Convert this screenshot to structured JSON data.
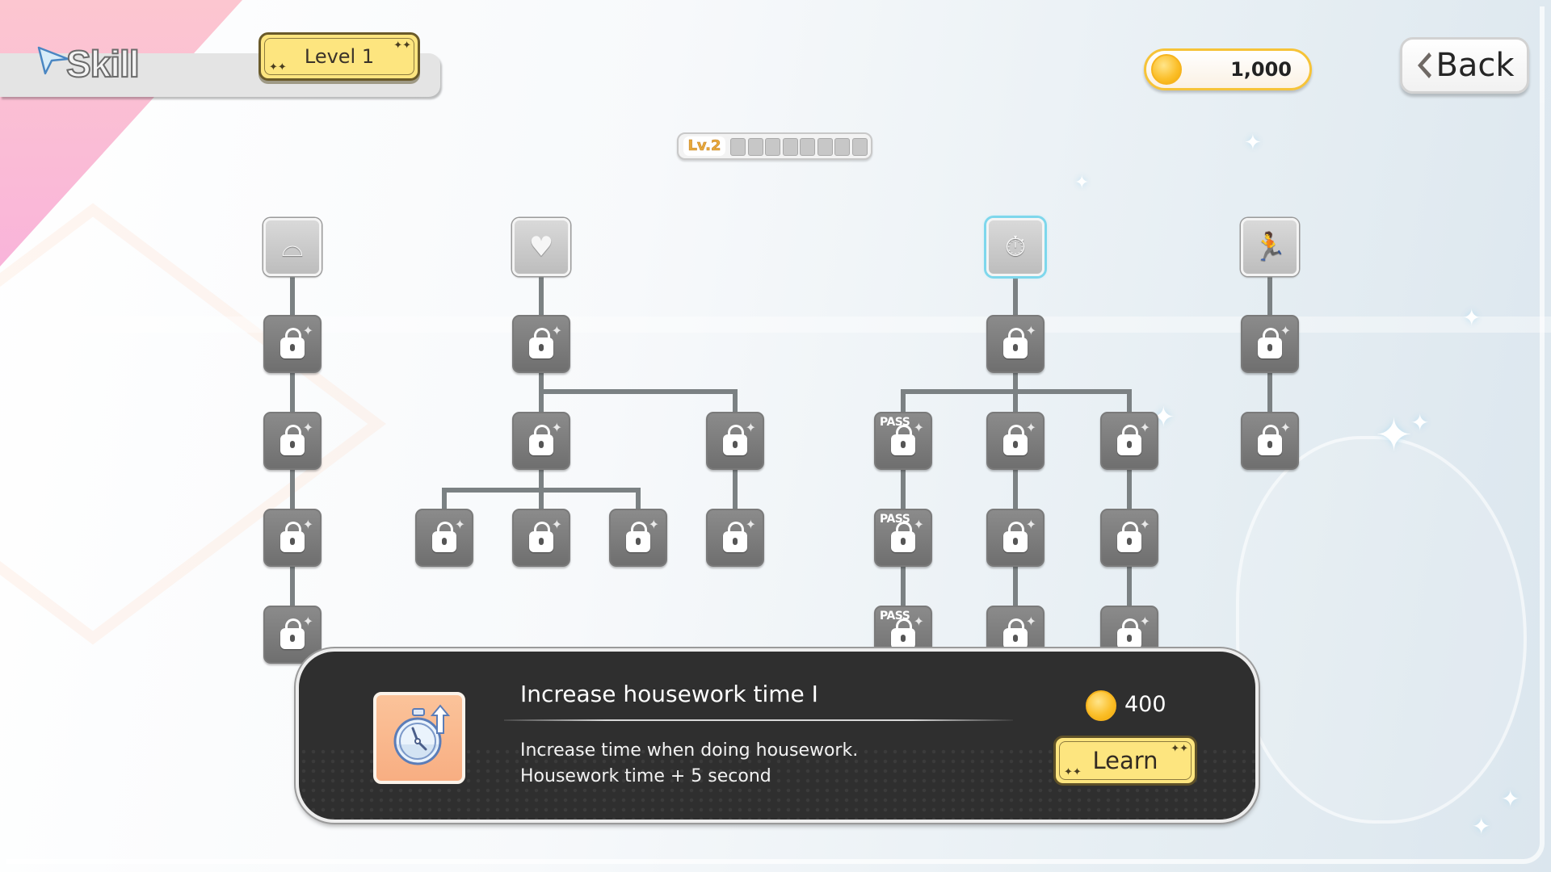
{
  "header": {
    "title": "Skill",
    "level_label": "Level 1",
    "coins": "1,000",
    "back_label": "Back"
  },
  "progress": {
    "level_label": "Lv.2",
    "segments_total": 8,
    "segments_filled": 0
  },
  "tree": {
    "nodes": [
      {
        "id": "laundry-root",
        "icon": "folded-towel-icon",
        "state": "unlocked",
        "glyph": "⌓"
      },
      {
        "id": "laundry-1",
        "icon": "laundry-icon",
        "state": "locked"
      },
      {
        "id": "laundry-2",
        "icon": "laundry-sparkle-icon",
        "state": "locked"
      },
      {
        "id": "laundry-3",
        "icon": "laundry-shine-icon",
        "state": "locked"
      },
      {
        "id": "laundry-4",
        "icon": "laundry-sleep-icon",
        "state": "locked"
      },
      {
        "id": "affection-root",
        "icon": "heart-up-icon",
        "state": "unlocked",
        "glyph": "♥"
      },
      {
        "id": "affection-1",
        "icon": "heart-sparkle-icon",
        "state": "locked"
      },
      {
        "id": "affection-2",
        "icon": "heart-glow-icon",
        "state": "locked"
      },
      {
        "id": "affection-2b",
        "icon": "gift-icon",
        "state": "locked"
      },
      {
        "id": "affection-3a",
        "icon": "character-heart-icon",
        "state": "locked"
      },
      {
        "id": "affection-3b",
        "icon": "character-heart-icon",
        "state": "locked"
      },
      {
        "id": "affection-3c",
        "icon": "character-heart-icon",
        "state": "locked"
      },
      {
        "id": "affection-3d",
        "icon": "gift-box-icon",
        "state": "locked"
      },
      {
        "id": "time-root",
        "icon": "stopwatch-up-icon",
        "state": "unlocked",
        "selected": true,
        "glyph": "⏱"
      },
      {
        "id": "time-1",
        "icon": "stopwatch-up-icon",
        "state": "locked"
      },
      {
        "id": "time-2a",
        "icon": "character-pass-icon",
        "state": "locked",
        "pass": "PASS"
      },
      {
        "id": "time-2b",
        "icon": "stopwatch-up-icon",
        "state": "locked"
      },
      {
        "id": "time-2c",
        "icon": "hand-up-icon",
        "state": "locked"
      },
      {
        "id": "time-3a",
        "icon": "character-pass-icon",
        "state": "locked",
        "pass": "PASS"
      },
      {
        "id": "time-3b",
        "icon": "stopwatch-glow-icon",
        "state": "locked"
      },
      {
        "id": "time-3c",
        "icon": "hand-up-icon",
        "state": "locked"
      },
      {
        "id": "time-4a",
        "icon": "item-pass-icon",
        "state": "locked",
        "pass": "PASS"
      },
      {
        "id": "time-4b",
        "icon": "stopwatch-shine-icon",
        "state": "locked"
      },
      {
        "id": "time-4c",
        "icon": "hand-coin-icon",
        "state": "locked"
      },
      {
        "id": "speed-root",
        "icon": "running-icon",
        "state": "unlocked",
        "glyph": "🏃"
      },
      {
        "id": "speed-1",
        "icon": "running-dash-icon",
        "state": "locked"
      },
      {
        "id": "speed-2",
        "icon": "running-fast-icon",
        "state": "locked"
      }
    ]
  },
  "selected_skill": {
    "name": "Increase housework time I",
    "description_line1": "Increase time when doing housework.",
    "description_line2": "Housework time + 5 second",
    "cost": "400",
    "learn_label": "Learn",
    "icon": "stopwatch-up-icon"
  },
  "colors": {
    "accent_yellow": "#fde57f",
    "coin_gold": "#fbc02d",
    "selected_outline": "#7ed7ec",
    "panel_dark": "#2f2f2f",
    "pink_corner": "#fbbad6"
  }
}
